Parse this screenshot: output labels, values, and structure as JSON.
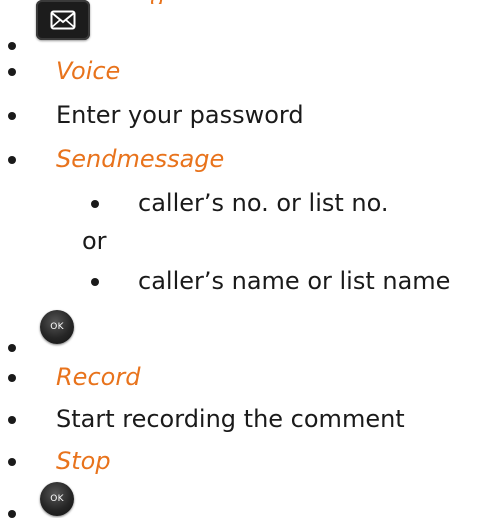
{
  "header": {
    "partial_heading": "g"
  },
  "steps": {
    "mail_key_icon": "envelope-icon",
    "voice": "Voice",
    "enter_password": "Enter your password",
    "sendmessage": "Sendmessage",
    "sub_option_1": "caller’s no. or list no.",
    "or": "or",
    "sub_option_2": "caller’s name or list name",
    "ok_key_label_1": "OK",
    "record": "Record",
    "start_recording": "Start recording the comment",
    "stop": "Stop",
    "ok_key_label_2": "OK"
  },
  "colors": {
    "keyword": "#e8731c",
    "text": "#1a1a1a"
  }
}
